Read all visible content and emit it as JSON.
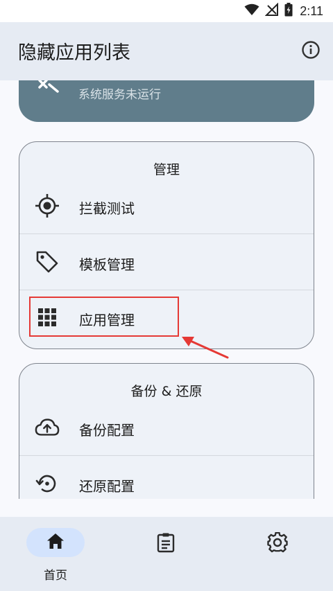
{
  "status_bar": {
    "time": "2:11"
  },
  "app_bar": {
    "title": "隐藏应用列表"
  },
  "status_card": {
    "text": "系统服务未运行"
  },
  "manage_card": {
    "title": "管理",
    "items": [
      {
        "label": "拦截测试",
        "icon": "target-icon"
      },
      {
        "label": "模板管理",
        "icon": "tag-icon"
      },
      {
        "label": "应用管理",
        "icon": "grid-apps-icon"
      }
    ]
  },
  "backup_card": {
    "title": "备份 & 还原",
    "items": [
      {
        "label": "备份配置",
        "icon": "cloud-upload-icon"
      },
      {
        "label": "还原配置",
        "icon": "restore-icon"
      }
    ]
  },
  "bottom_nav": {
    "items": [
      {
        "label": "首页",
        "icon": "home-icon",
        "selected": true
      },
      {
        "label": "",
        "icon": "clipboard-icon",
        "selected": false
      },
      {
        "label": "",
        "icon": "gear-icon",
        "selected": false
      }
    ]
  },
  "colors": {
    "app_bar_bg": "#e6ebf3",
    "status_card_bg": "#607d8b",
    "card_bg": "#eef2f8",
    "nav_pill": "#d3e3fd",
    "highlight": "#e53935"
  }
}
